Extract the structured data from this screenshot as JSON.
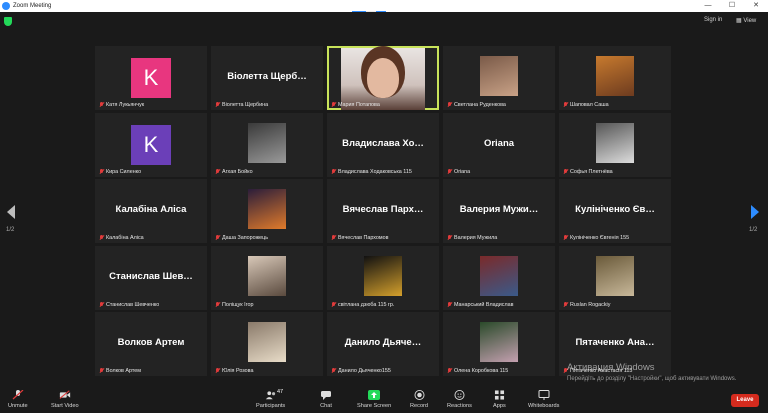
{
  "window": {
    "title": "Zoom Meeting",
    "controls": [
      "—",
      "☐",
      "✕"
    ]
  },
  "header": {
    "sign_in": "Sign in",
    "view": "View"
  },
  "pager": {
    "left": "1/2",
    "right": "1/2"
  },
  "tiles": [
    {
      "type": "avatar",
      "letter": "K",
      "color": "#e8367f",
      "label": "Катя Лукьянчук"
    },
    {
      "type": "text",
      "name": "Віолетта Щерб…",
      "label": "Віолетта Щербина"
    },
    {
      "type": "video",
      "label": "Мария Потапова",
      "active": true
    },
    {
      "type": "photo",
      "label": "Светлана Руденкова"
    },
    {
      "type": "photo",
      "label": "Шаповал Саша"
    },
    {
      "type": "avatar",
      "letter": "K",
      "color": "#6b3fb8",
      "label": "Кира Силенко"
    },
    {
      "type": "photo",
      "label": "Агхая Бойко"
    },
    {
      "type": "text",
      "name": "Владислава Хо…",
      "label": "Владислава Ходаковська 115"
    },
    {
      "type": "text",
      "name": "Oriana",
      "label": "Oriana"
    },
    {
      "type": "photo",
      "label": "Софья Плетнёва"
    },
    {
      "type": "text",
      "name": "Калабіна Аліса",
      "label": "Калабіна Аліса"
    },
    {
      "type": "photo",
      "label": "Даша Запорожець"
    },
    {
      "type": "text",
      "name": "Вячеслав Парх…",
      "label": "Вячеслав Пархомов"
    },
    {
      "type": "text",
      "name": "Валерия Мужи…",
      "label": "Валерия Мужила"
    },
    {
      "type": "text",
      "name": "Кулініченко Єв…",
      "label": "Кулініченко Євгенія 155"
    },
    {
      "type": "text",
      "name": "Станислав Шев…",
      "label": "Станислав Шевченко"
    },
    {
      "type": "photo",
      "label": "Поліщук Ігор"
    },
    {
      "type": "photo",
      "label": "світлана дзюба 115 гр."
    },
    {
      "type": "photo",
      "label": "Манарський Владислав"
    },
    {
      "type": "photo",
      "label": "Ruslan Rogackiy"
    },
    {
      "type": "text",
      "name": "Волков Артем",
      "label": "Волков Артем"
    },
    {
      "type": "photo",
      "label": "Юлія Розова"
    },
    {
      "type": "text",
      "name": "Данило Дьяче…",
      "label": "Данило Дьяченко155"
    },
    {
      "type": "photo",
      "label": "Олена Коробкова 115"
    },
    {
      "type": "text",
      "name": "Пятаченко Ана…",
      "label": "Пятаченко Анастасія 115"
    }
  ],
  "toolbar": {
    "unmute": "Unmute",
    "start_video": "Start Video",
    "participants": "Participants",
    "participants_count": "47",
    "chat": "Chat",
    "share_screen": "Share Screen",
    "record": "Record",
    "reactions": "Reactions",
    "apps": "Apps",
    "whiteboards": "Whiteboards",
    "leave": "Leave"
  },
  "watermark": {
    "line1": "Активация Windows",
    "line2": "Перейдіть до розділу \"Настройки\", щоб активувати Windows."
  },
  "colors": {
    "accent_green": "#23d959",
    "active_border": "#c8e35a",
    "leave": "#d52b1e",
    "share": "#23d959",
    "arrow": "#2d8cff"
  }
}
